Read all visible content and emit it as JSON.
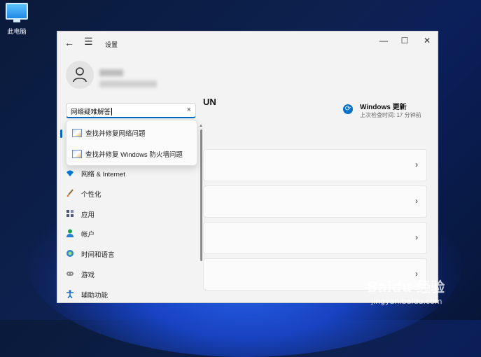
{
  "desktop": {
    "icon_label": "此电脑"
  },
  "window": {
    "title": "设置",
    "controls": {
      "minimize": "—",
      "maximize": "☐",
      "close": "✕"
    }
  },
  "search": {
    "value": "网络疑难解答",
    "clear": "×"
  },
  "suggestions": [
    {
      "label": "查找并修复网络问题"
    },
    {
      "label": "查找并修复 Windows 防火墙问题"
    }
  ],
  "nav": [
    {
      "label": "网络 & Internet",
      "icon": "wifi-icon",
      "color": "#0078d4"
    },
    {
      "label": "个性化",
      "icon": "brush-icon",
      "color": "#e3741b"
    },
    {
      "label": "应用",
      "icon": "apps-icon",
      "color": "#4c5a7a"
    },
    {
      "label": "帐户",
      "icon": "account-icon",
      "color": "#17a34a"
    },
    {
      "label": "时间和语言",
      "icon": "globe-clock-icon",
      "color": "#2f86d6"
    },
    {
      "label": "游戏",
      "icon": "gamepad-icon",
      "color": "#6a6a6a"
    },
    {
      "label": "辅助功能",
      "icon": "accessibility-icon",
      "color": "#1b6fc4"
    }
  ],
  "heading_fragment": "UN",
  "update": {
    "title": "Windows 更新",
    "subtitle": "上次检查时间: 17 分钟前"
  },
  "watermark": {
    "brand": "Baidu 经验",
    "url": "jingyan.baidu.com"
  },
  "colors": {
    "accent": "#0067c0"
  }
}
